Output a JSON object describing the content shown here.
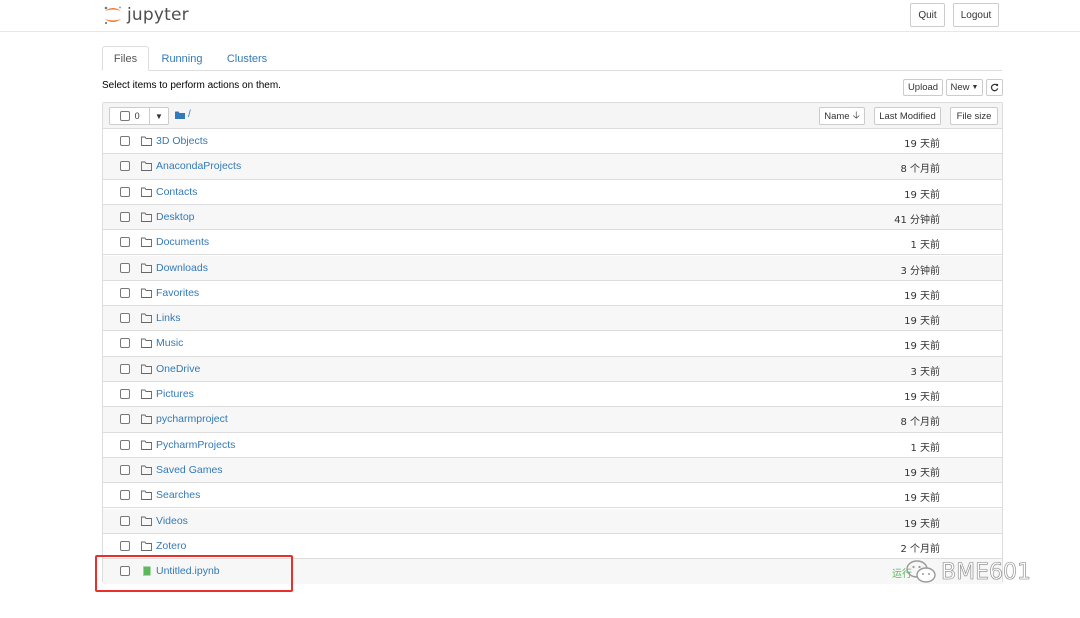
{
  "header": {
    "brand": "jupyter",
    "quit_label": "Quit",
    "logout_label": "Logout"
  },
  "tabs": [
    {
      "label": "Files",
      "active": true
    },
    {
      "label": "Running",
      "active": false
    },
    {
      "label": "Clusters",
      "active": false
    }
  ],
  "toolbar": {
    "hint": "Select items to perform actions on them.",
    "upload_label": "Upload",
    "new_label": "New",
    "refresh_icon": "refresh-icon"
  },
  "list_header": {
    "selected_count": "0",
    "breadcrumb": "/",
    "sort_name_label": "Name",
    "sort_modified_label": "Last Modified",
    "sort_size_label": "File size"
  },
  "files": [
    {
      "name": "3D Objects",
      "type": "folder",
      "modified": "19 天前"
    },
    {
      "name": "AnacondaProjects",
      "type": "folder",
      "modified": "8 个月前"
    },
    {
      "name": "Contacts",
      "type": "folder",
      "modified": "19 天前"
    },
    {
      "name": "Desktop",
      "type": "folder",
      "modified": "41 分钟前"
    },
    {
      "name": "Documents",
      "type": "folder",
      "modified": "1 天前"
    },
    {
      "name": "Downloads",
      "type": "folder",
      "modified": "3 分钟前"
    },
    {
      "name": "Favorites",
      "type": "folder",
      "modified": "19 天前"
    },
    {
      "name": "Links",
      "type": "folder",
      "modified": "19 天前"
    },
    {
      "name": "Music",
      "type": "folder",
      "modified": "19 天前"
    },
    {
      "name": "OneDrive",
      "type": "folder",
      "modified": "3 天前"
    },
    {
      "name": "Pictures",
      "type": "folder",
      "modified": "19 天前"
    },
    {
      "name": "pycharmproject",
      "type": "folder",
      "modified": "8 个月前"
    },
    {
      "name": "PycharmProjects",
      "type": "folder",
      "modified": "1 天前"
    },
    {
      "name": "Saved Games",
      "type": "folder",
      "modified": "19 天前"
    },
    {
      "name": "Searches",
      "type": "folder",
      "modified": "19 天前"
    },
    {
      "name": "Videos",
      "type": "folder",
      "modified": "19 天前"
    },
    {
      "name": "Zotero",
      "type": "folder",
      "modified": "2 个月前"
    },
    {
      "name": "Untitled.ipynb",
      "type": "notebook",
      "modified": "",
      "status": "运行"
    }
  ],
  "watermark": "BME601",
  "colors": {
    "link": "#337ab7",
    "highlight": "#e8302a",
    "notebook_icon": "#5cb85c"
  }
}
